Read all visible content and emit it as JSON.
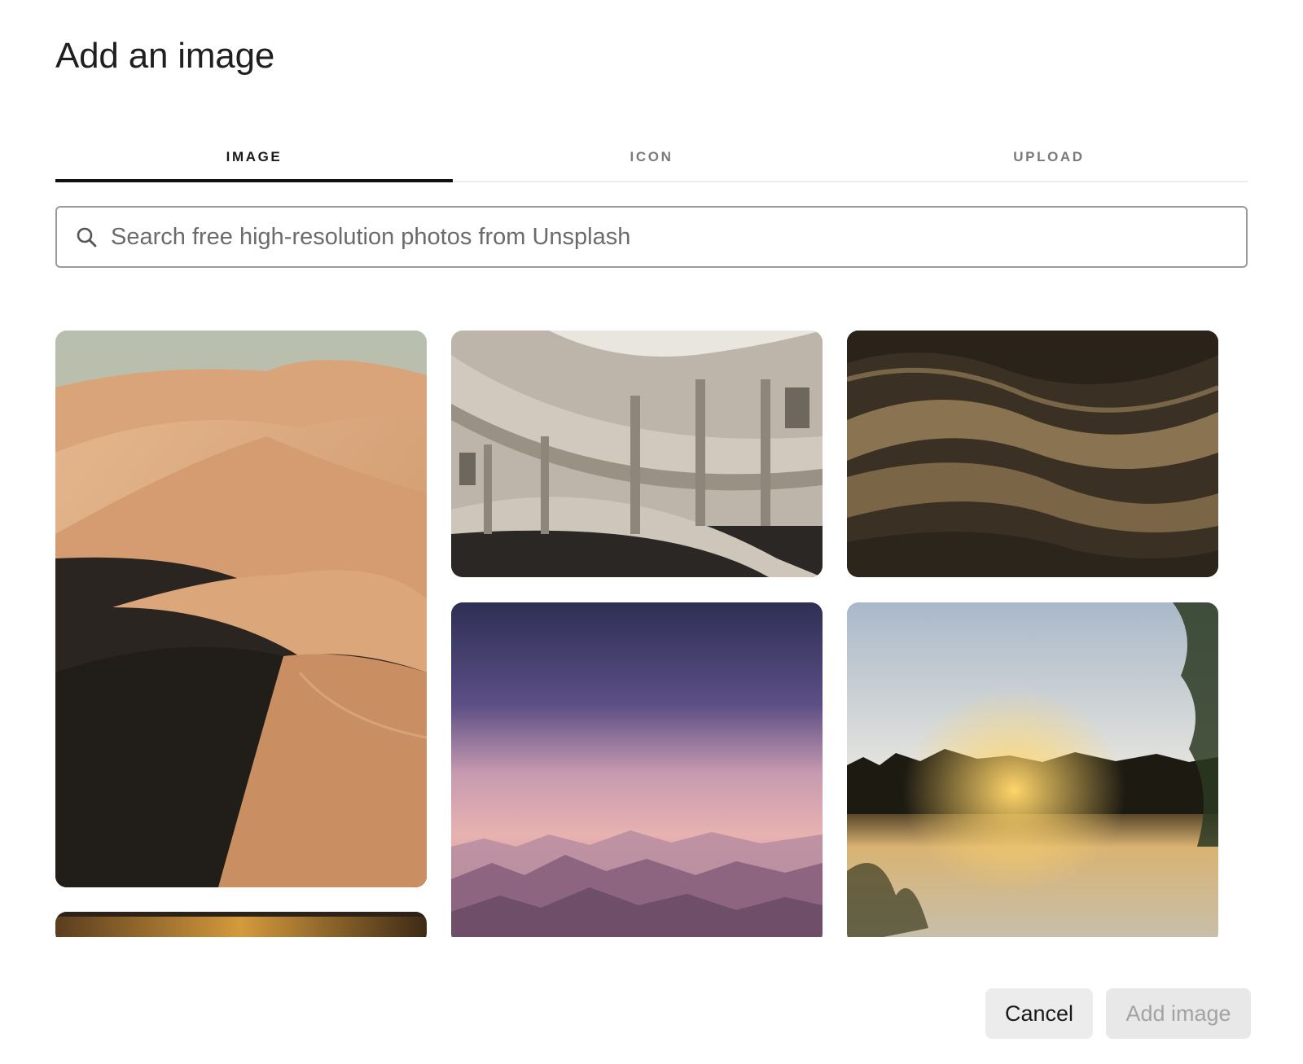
{
  "dialog": {
    "title": "Add an image"
  },
  "tabs": [
    {
      "label": "IMAGE",
      "active": true
    },
    {
      "label": "ICON",
      "active": false
    },
    {
      "label": "UPLOAD",
      "active": false
    }
  ],
  "search": {
    "placeholder": "Search free high-resolution photos from Unsplash",
    "value": "",
    "icon": "search-icon"
  },
  "photos": [
    {
      "subject": "desert-dunes"
    },
    {
      "subject": "curved-architecture"
    },
    {
      "subject": "sand-texture"
    },
    {
      "subject": "purple-sky-mountains"
    },
    {
      "subject": "lake-sunset"
    },
    {
      "subject": "golden-landscape-partial"
    }
  ],
  "footer": {
    "cancel_label": "Cancel",
    "add_label": "Add image",
    "add_enabled": false
  },
  "colors": {
    "active_tab_underline": "#111111",
    "inactive_tab_text": "#7a7a7a",
    "button_bg": "#ececec",
    "disabled_text": "#a3a3a3"
  }
}
